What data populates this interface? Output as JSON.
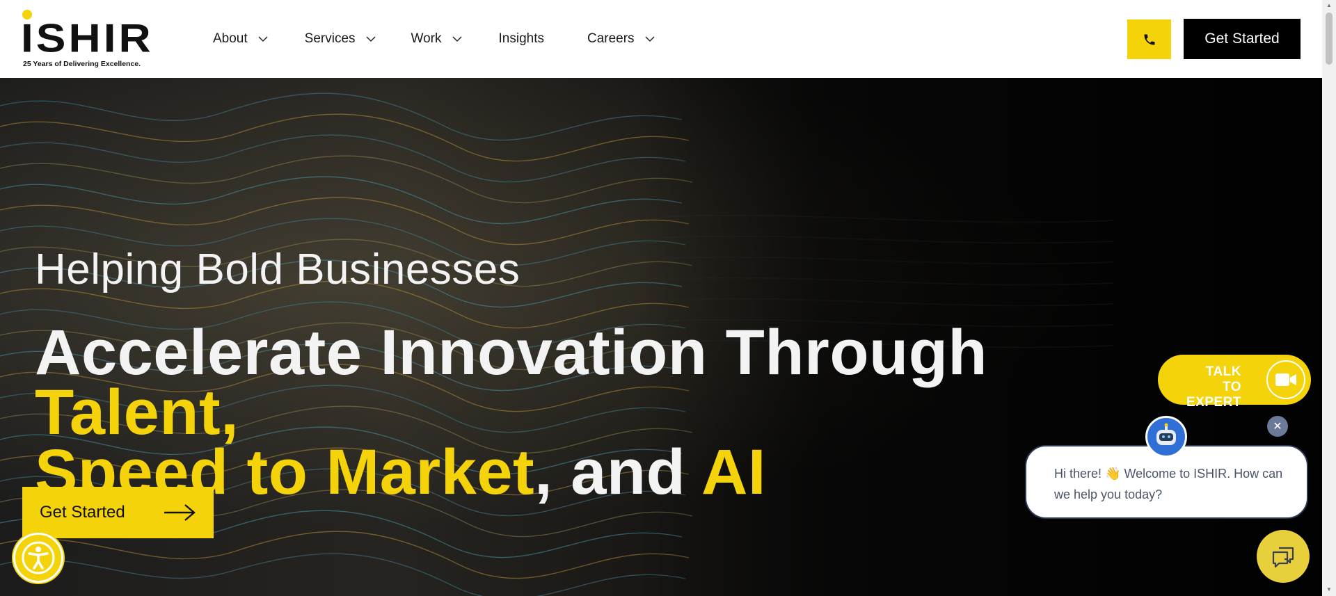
{
  "brand": {
    "name": "ISHIR",
    "tagline": "25 Years of Delivering Excellence.",
    "accent_color": "#f5d30a",
    "dark_color": "#000000"
  },
  "nav": {
    "items": [
      {
        "label": "About",
        "has_dropdown": true
      },
      {
        "label": "Services",
        "has_dropdown": true
      },
      {
        "label": "Work",
        "has_dropdown": true
      },
      {
        "label": "Insights",
        "has_dropdown": false
      },
      {
        "label": "Careers",
        "has_dropdown": true
      }
    ],
    "phone_icon": "phone-icon",
    "cta_label": "Get Started"
  },
  "hero": {
    "subtitle": "Helping Bold Businesses",
    "title_part1": "Accelerate Innovation Through ",
    "title_highlight1": "Talent,",
    "title_highlight2": "Speed to Market",
    "title_part2": ", and ",
    "title_highlight3": "AI",
    "cta_label": "Get Started"
  },
  "widgets": {
    "talk_to_expert_line1": "TALK TO",
    "talk_to_expert_line2": "EXPERT",
    "chat_message": "Hi there! 👋 Welcome to ISHIR. How can we help you today?",
    "close_symbol": "✕",
    "accessibility_icon": "accessibility-icon",
    "chat_icon": "chat-icon"
  }
}
